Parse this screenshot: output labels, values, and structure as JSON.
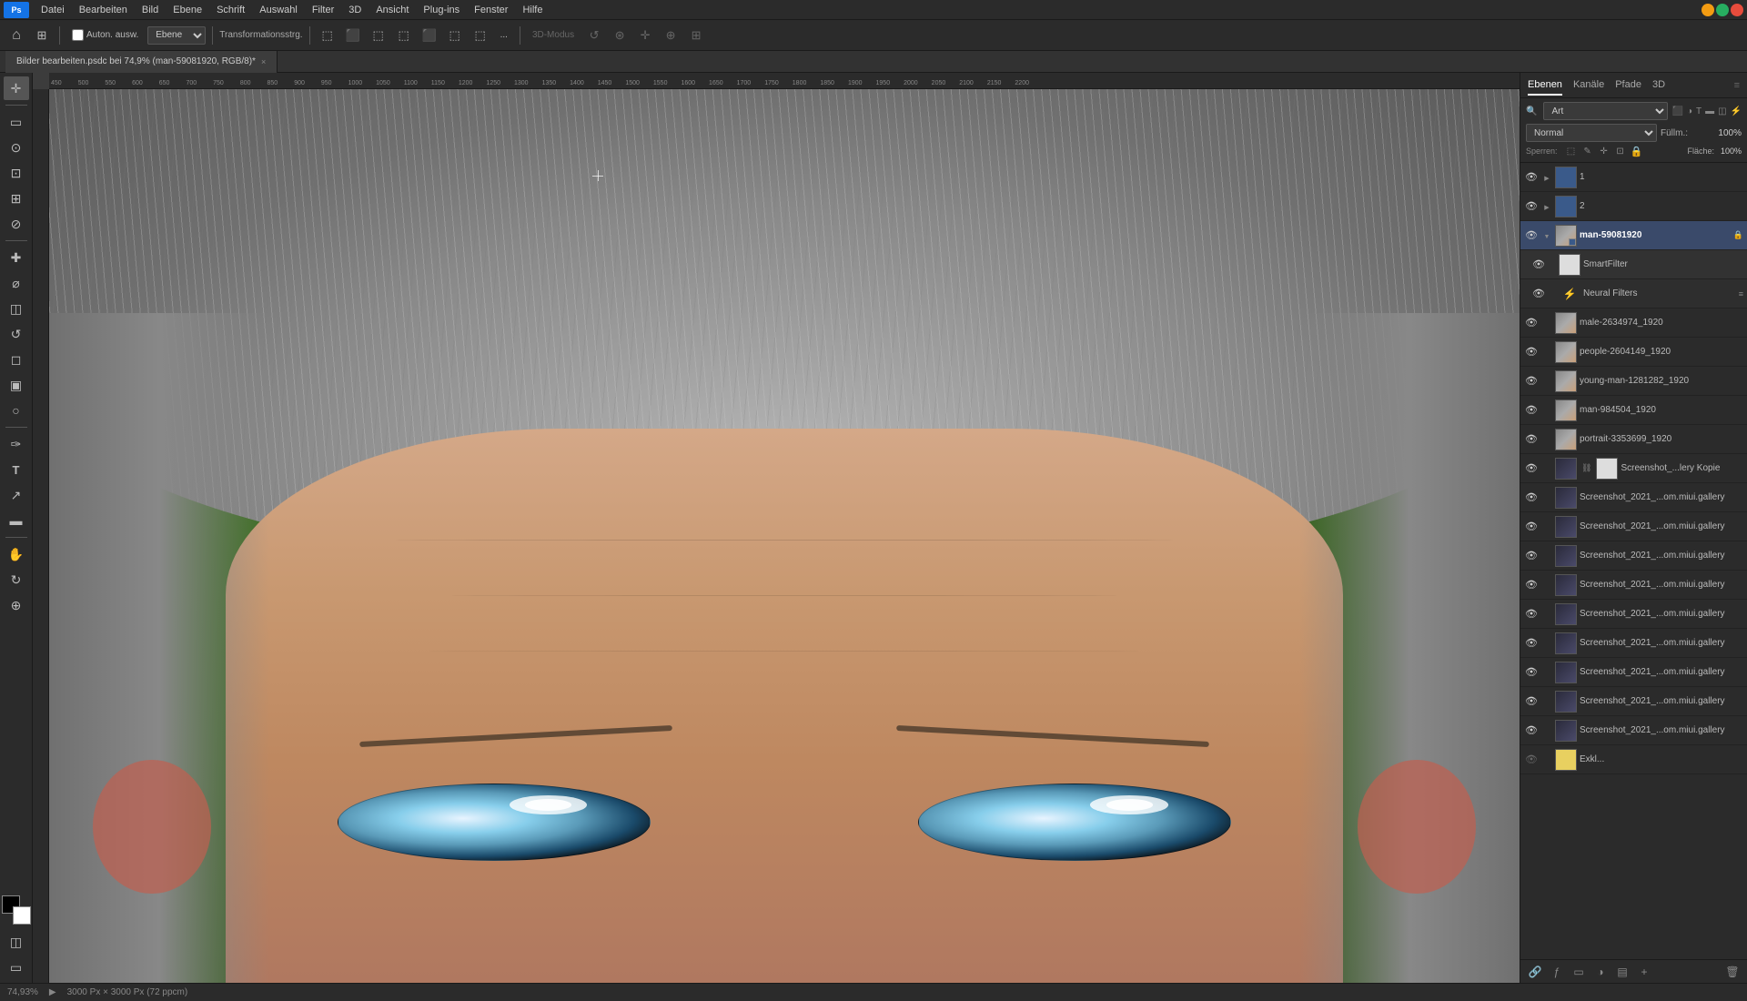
{
  "app": {
    "title": "Adobe Photoshop",
    "logo": "Ps"
  },
  "menubar": {
    "items": [
      "Datei",
      "Bearbeiten",
      "Bild",
      "Ebene",
      "Schrift",
      "Auswahl",
      "Filter",
      "3D",
      "Ansicht",
      "Plug-ins",
      "Fenster",
      "Hilfe"
    ]
  },
  "toolbar": {
    "auton_label": "Auton. ausw.",
    "layer_select": "Ebene",
    "transform_label": "Transformationsstrg.",
    "more_label": "..."
  },
  "tabbar": {
    "active_tab": "Bilder bearbeiten.psdc bei 74,9% (man-59081920, RGB/8)*",
    "close_label": "×"
  },
  "canvas": {
    "zoom_level": "74,93%",
    "image_info": "3000 Px × 3000 Px (72 ppcm)"
  },
  "ruler": {
    "unit": "px",
    "ticks": [
      "450",
      "500",
      "550",
      "600",
      "650",
      "700",
      "750",
      "800",
      "850",
      "900",
      "950",
      "1000",
      "1050",
      "1100",
      "1150",
      "1200",
      "1250",
      "1300",
      "1350",
      "1400",
      "1450",
      "1500",
      "1550",
      "1600",
      "1650",
      "1700",
      "1750",
      "1800",
      "1850",
      "1900",
      "1950",
      "2000",
      "2050",
      "2100",
      "2150",
      "2200"
    ]
  },
  "right_panel": {
    "tabs": [
      "Ebenen",
      "Kanäle",
      "Pfade",
      "3D"
    ],
    "active_tab": "Ebenen"
  },
  "layers_controls": {
    "filter_type": "Art",
    "blend_mode": "Normal",
    "opacity_label": "Füllm.:",
    "opacity_value": "100%",
    "fill_label": "Fläche:",
    "fill_value": "100%"
  },
  "layers": [
    {
      "id": "l1",
      "name": "1",
      "type": "group",
      "visible": true,
      "expanded": false,
      "indent": 0,
      "thumb": "blue"
    },
    {
      "id": "l2",
      "name": "2",
      "type": "group",
      "visible": true,
      "expanded": false,
      "indent": 0,
      "thumb": "blue"
    },
    {
      "id": "l3",
      "name": "man-59081920",
      "type": "smart",
      "visible": true,
      "expanded": true,
      "indent": 0,
      "thumb": "portrait",
      "active": true
    },
    {
      "id": "l3a",
      "name": "SmartFilter",
      "type": "smartfilter",
      "visible": true,
      "expanded": false,
      "indent": 1,
      "thumb": "white"
    },
    {
      "id": "l3b",
      "name": "Neural Filters",
      "type": "neural",
      "visible": true,
      "expanded": false,
      "indent": 1,
      "thumb": null
    },
    {
      "id": "l4",
      "name": "male-2634974_1920",
      "type": "layer",
      "visible": true,
      "expanded": false,
      "indent": 0,
      "thumb": "portrait"
    },
    {
      "id": "l5",
      "name": "people-2604149_1920",
      "type": "layer",
      "visible": true,
      "expanded": false,
      "indent": 0,
      "thumb": "portrait"
    },
    {
      "id": "l6",
      "name": "young-man-1281282_1920",
      "type": "layer",
      "visible": true,
      "expanded": false,
      "indent": 0,
      "thumb": "portrait"
    },
    {
      "id": "l7",
      "name": "man-984504_1920",
      "type": "layer",
      "visible": true,
      "expanded": false,
      "indent": 0,
      "thumb": "portrait"
    },
    {
      "id": "l8",
      "name": "portrait-3353699_1920",
      "type": "layer",
      "visible": true,
      "expanded": false,
      "indent": 0,
      "thumb": "portrait"
    },
    {
      "id": "l9",
      "name": "Screenshot_...lery Kopie",
      "type": "layer",
      "visible": true,
      "expanded": false,
      "indent": 0,
      "thumb": "screenshot",
      "has_mask": true
    },
    {
      "id": "l10",
      "name": "Screenshot_2021_...om.miui.gallery",
      "type": "layer",
      "visible": true,
      "expanded": false,
      "indent": 0,
      "thumb": "screenshot"
    },
    {
      "id": "l11",
      "name": "Screenshot_2021_...om.miui.gallery",
      "type": "layer",
      "visible": true,
      "expanded": false,
      "indent": 0,
      "thumb": "screenshot"
    },
    {
      "id": "l12",
      "name": "Screenshot_2021_...om.miui.gallery",
      "type": "layer",
      "visible": true,
      "expanded": false,
      "indent": 0,
      "thumb": "screenshot"
    },
    {
      "id": "l13",
      "name": "Screenshot_2021_...om.miui.gallery",
      "type": "layer",
      "visible": true,
      "expanded": false,
      "indent": 0,
      "thumb": "screenshot"
    },
    {
      "id": "l14",
      "name": "Screenshot_2021_...om.miui.gallery",
      "type": "layer",
      "visible": true,
      "expanded": false,
      "indent": 0,
      "thumb": "screenshot"
    },
    {
      "id": "l15",
      "name": "Screenshot_2021_...om.miui.gallery",
      "type": "layer",
      "visible": true,
      "expanded": false,
      "indent": 0,
      "thumb": "screenshot"
    },
    {
      "id": "l16",
      "name": "Screenshot_2021_...om.miui.gallery",
      "type": "layer",
      "visible": true,
      "expanded": false,
      "indent": 0,
      "thumb": "screenshot"
    },
    {
      "id": "l17",
      "name": "Screenshot_2021_...om.miui.gallery",
      "type": "layer",
      "visible": true,
      "expanded": false,
      "indent": 0,
      "thumb": "screenshot"
    },
    {
      "id": "l18",
      "name": "Screenshot_2021_...om.miui.gallery",
      "type": "layer",
      "visible": true,
      "expanded": false,
      "indent": 0,
      "thumb": "screenshot"
    },
    {
      "id": "l19",
      "name": "Exkl...",
      "type": "layer",
      "visible": true,
      "expanded": false,
      "indent": 0,
      "thumb": "yellow"
    }
  ],
  "panel_bottom": {
    "buttons": [
      "link-icon",
      "fx-icon",
      "mask-icon",
      "adjustment-icon",
      "group-icon",
      "new-layer-icon",
      "delete-icon"
    ]
  },
  "statusbar": {
    "zoom": "74,93%",
    "info": "3000 Px × 3000 Px (72 ppcm)"
  },
  "tools": {
    "items": [
      {
        "name": "move",
        "icon": "✛"
      },
      {
        "name": "marquee",
        "icon": "▭"
      },
      {
        "name": "lasso",
        "icon": "⊙"
      },
      {
        "name": "crop",
        "icon": "⊡"
      },
      {
        "name": "eyedropper",
        "icon": "⊘"
      },
      {
        "name": "healing",
        "icon": "✚"
      },
      {
        "name": "brush",
        "icon": "⌀"
      },
      {
        "name": "stamp",
        "icon": "◫"
      },
      {
        "name": "history-brush",
        "icon": "↺"
      },
      {
        "name": "eraser",
        "icon": "◻"
      },
      {
        "name": "gradient",
        "icon": "▣"
      },
      {
        "name": "dodge",
        "icon": "○"
      },
      {
        "name": "pen",
        "icon": "✑"
      },
      {
        "name": "text",
        "icon": "T"
      },
      {
        "name": "selection",
        "icon": "↗"
      },
      {
        "name": "shapes",
        "icon": "▬"
      },
      {
        "name": "3d-rotate",
        "icon": "↻"
      },
      {
        "name": "zoom",
        "icon": "⊕"
      }
    ]
  }
}
